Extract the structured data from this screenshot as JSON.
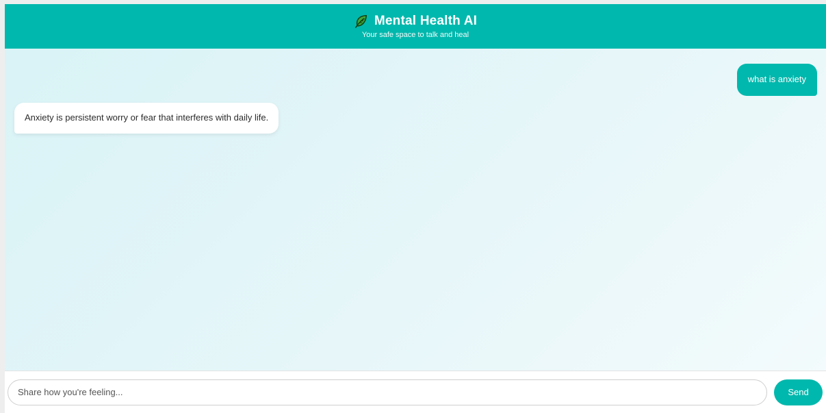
{
  "header": {
    "icon": "leaf-icon",
    "title": "Mental Health AI",
    "subtitle": "Your safe space to talk and heal"
  },
  "messages": [
    {
      "role": "user",
      "text": "what is anxiety"
    },
    {
      "role": "bot",
      "text": "Anxiety is persistent worry or fear that interferes with daily life."
    }
  ],
  "input": {
    "placeholder": "Share how you're feeling...",
    "value": ""
  },
  "send_label": "Send",
  "colors": {
    "accent": "#00b8ad",
    "chat_background": "#e2f5f8",
    "bot_bubble": "#ffffff"
  }
}
